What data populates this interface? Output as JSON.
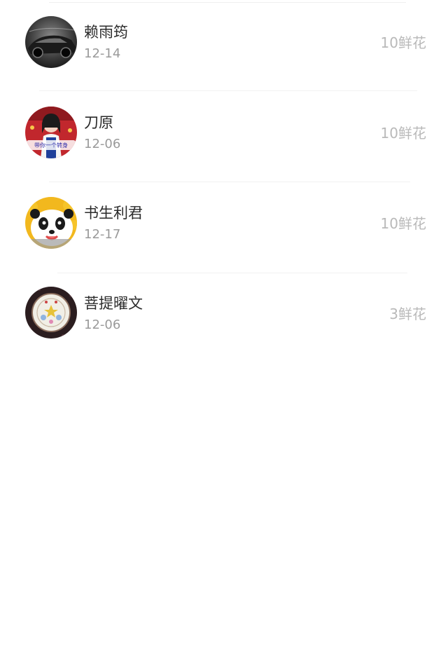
{
  "flower_list": {
    "items": [
      {
        "name": "赖雨筠",
        "date": "12-14",
        "flowers": "10鲜花",
        "avatar_icon": "sports-car-avatar"
      },
      {
        "name": "刀原",
        "date": "12-06",
        "flowers": "10鲜花",
        "avatar_icon": "girl-photo-avatar",
        "avatar_caption": "带你一个转身"
      },
      {
        "name": "书生利君",
        "date": "12-17",
        "flowers": "10鲜花",
        "avatar_icon": "panda-cartoon-avatar"
      },
      {
        "name": "菩提曜文",
        "date": "12-06",
        "flowers": "3鲜花",
        "avatar_icon": "decorative-plate-avatar"
      }
    ]
  }
}
